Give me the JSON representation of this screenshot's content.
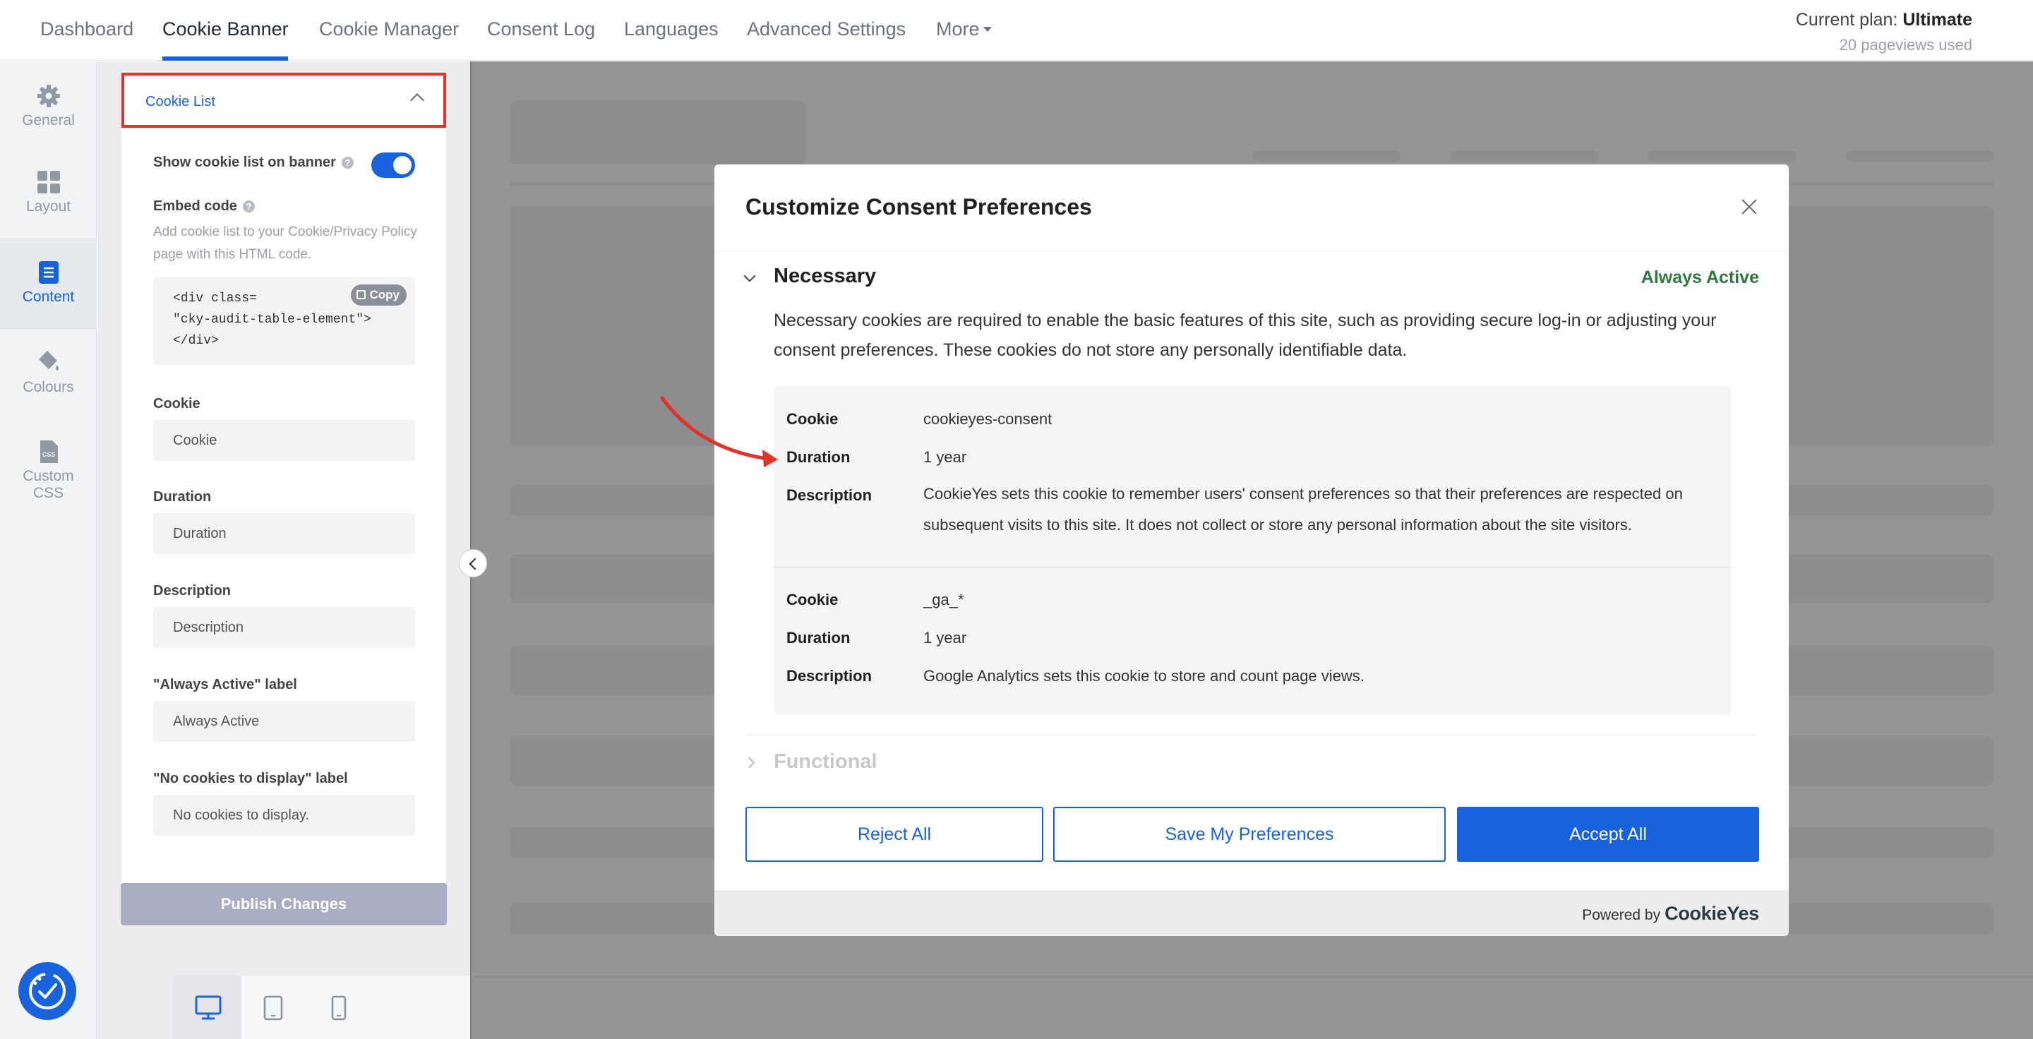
{
  "nav": {
    "items": [
      {
        "label": "Dashboard"
      },
      {
        "label": "Cookie Banner"
      },
      {
        "label": "Cookie Manager"
      },
      {
        "label": "Consent Log"
      },
      {
        "label": "Languages"
      },
      {
        "label": "Advanced Settings"
      },
      {
        "label": "More"
      }
    ],
    "active": "Cookie Banner",
    "plan_prefix": "Current plan:",
    "plan_name": "Ultimate",
    "pageviews": "20 pageviews used"
  },
  "rail": {
    "items": [
      {
        "label": "General",
        "icon": "gear-icon"
      },
      {
        "label": "Layout",
        "icon": "layout-grid-icon"
      },
      {
        "label": "Content",
        "icon": "document-icon"
      },
      {
        "label": "Colours",
        "icon": "paint-bucket-icon"
      },
      {
        "label": "Custom CSS",
        "icon": "css-file-icon"
      }
    ],
    "active": "Content"
  },
  "panel": {
    "section_title": "Cookie List",
    "show_list_label": "Show cookie list on banner",
    "show_list_enabled": true,
    "embed_label": "Embed code",
    "embed_hint": "Add cookie list to your Cookie/Privacy Policy page with this HTML code.",
    "code_lines": [
      "<div class=",
      "\"cky-audit-table-element\">",
      "</div>"
    ],
    "copy_label": "Copy",
    "fields": [
      {
        "label": "Cookie",
        "value": "Cookie"
      },
      {
        "label": "Duration",
        "value": "Duration"
      },
      {
        "label": "Description",
        "value": "Description"
      },
      {
        "label": "\"Always Active\" label",
        "value": "Always Active"
      },
      {
        "label": "\"No cookies to display\" label",
        "value": "No cookies to display."
      }
    ],
    "publish_label": "Publish Changes"
  },
  "devices": [
    "desktop-icon",
    "tablet-icon",
    "mobile-icon"
  ],
  "modal": {
    "title": "Customize Consent Preferences",
    "necessary": {
      "title": "Necessary",
      "status": "Always Active",
      "description": "Necessary cookies are required to enable the basic features of this site, such as providing secure log-in or adjusting your consent preferences. These cookies do not store any personally identifiable data.",
      "cookies": [
        {
          "cookie_label": "Cookie",
          "cookie": "cookieyes-consent",
          "duration_label": "Duration",
          "duration": "1 year",
          "description_label": "Description",
          "description": "CookieYes sets this cookie to remember users' consent preferences so that their preferences are respected on subsequent visits to this site. It does not collect or store any personal information about the site visitors."
        },
        {
          "cookie_label": "Cookie",
          "cookie": "_ga_*",
          "duration_label": "Duration",
          "duration": "1 year",
          "description_label": "Description",
          "description": "Google Analytics sets this cookie to store and count page views."
        }
      ]
    },
    "functional_title": "Functional",
    "buttons": {
      "reject": "Reject All",
      "save": "Save My Preferences",
      "accept": "Accept All"
    },
    "powered_by": "Powered by",
    "brand": "CookieYes"
  },
  "colors": {
    "accent": "#1863dc",
    "annotation": "#e0332a",
    "always_active": "#2d7a3d",
    "overlay": "#959595"
  }
}
